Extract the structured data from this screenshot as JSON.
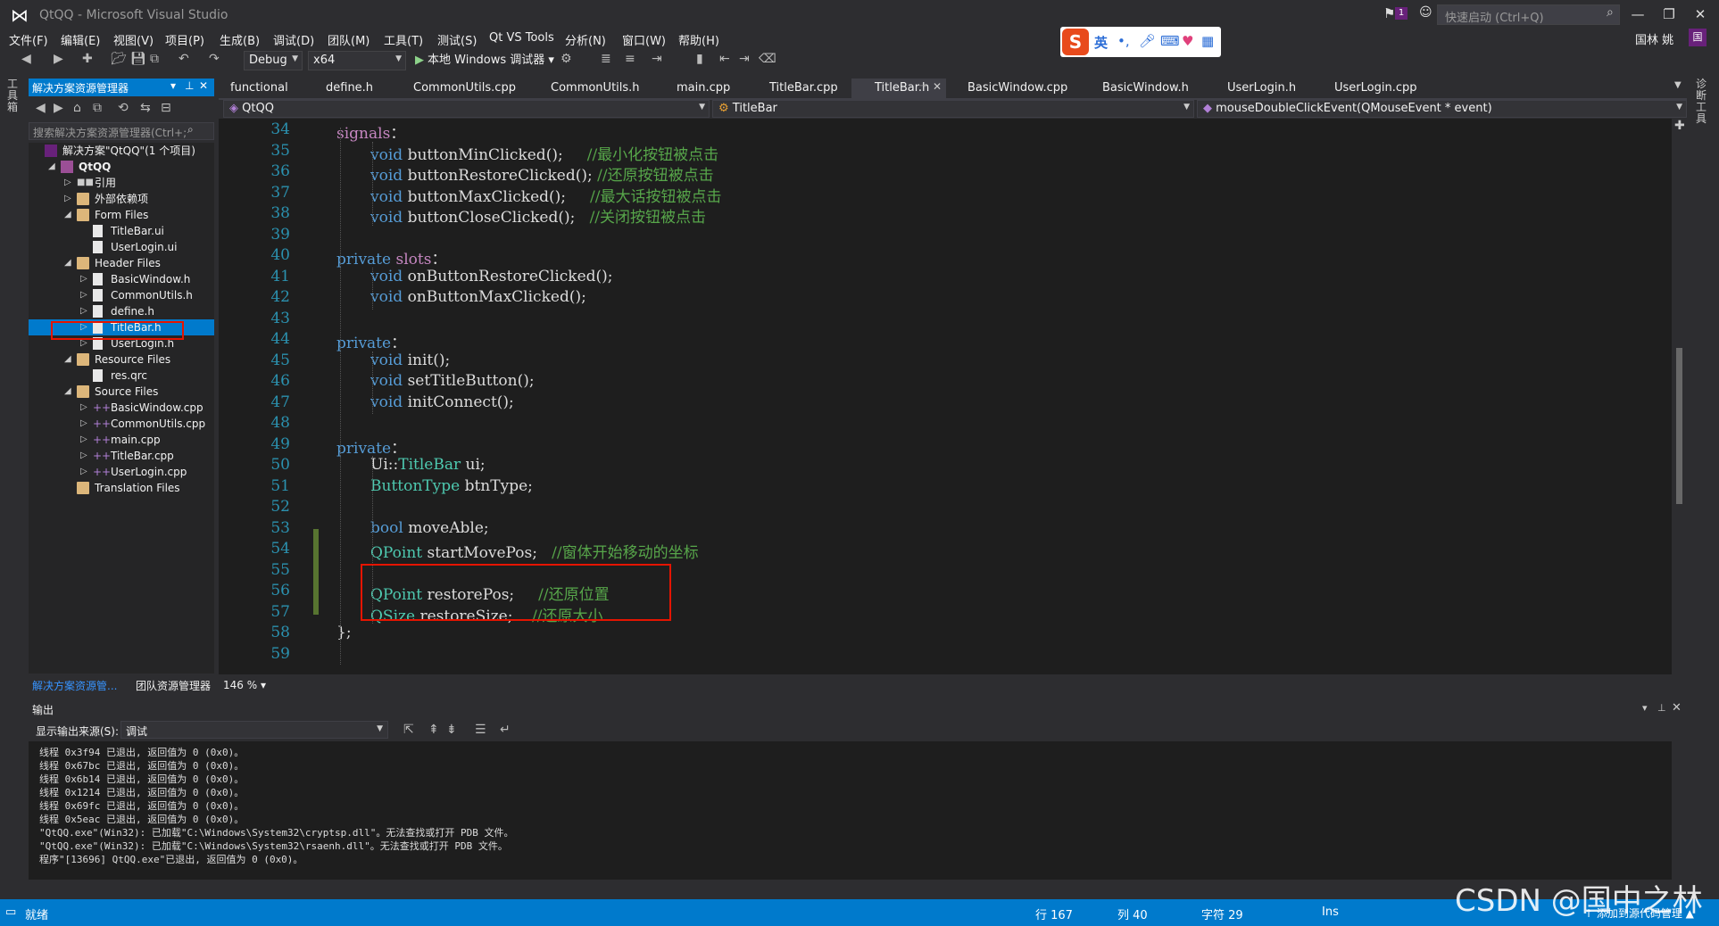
{
  "window": {
    "title": "QtQQ - Microsoft Visual Studio",
    "quick_launch_placeholder": "快速启动 (Ctrl+Q)",
    "notification_count": "1",
    "user_name": "国林 姚",
    "user_initial": "国"
  },
  "menu": [
    "文件(F)",
    "编辑(E)",
    "视图(V)",
    "项目(P)",
    "生成(B)",
    "调试(D)",
    "团队(M)",
    "工具(T)",
    "测试(S)",
    "Qt VS Tools",
    "分析(N)",
    "窗口(W)",
    "帮助(H)"
  ],
  "ime": {
    "lang": "英"
  },
  "toolbar": {
    "config": "Debug",
    "platform": "x64",
    "run_label": "本地 Windows 调试器"
  },
  "left_strip": "工具箱",
  "right_strip": "诊断工具",
  "solution_explorer": {
    "title": "解决方案资源管理器",
    "search_placeholder": "搜索解决方案资源管理器(Ctrl+;",
    "items": [
      {
        "label": "解决方案\"QtQQ\"(1 个项目)",
        "level": 0,
        "icon": "solution-icon",
        "expander": ""
      },
      {
        "label": "QtQQ",
        "level": 1,
        "icon": "project-icon",
        "expander": "◢"
      },
      {
        "label": "引用",
        "level": 2,
        "icon": "references-icon",
        "expander": "▷"
      },
      {
        "label": "外部依赖项",
        "level": 2,
        "icon": "folder-icon",
        "expander": "▷"
      },
      {
        "label": "Form Files",
        "level": 2,
        "icon": "folder-icon",
        "expander": "◢"
      },
      {
        "label": "TitleBar.ui",
        "level": 3,
        "icon": "file-icon",
        "expander": ""
      },
      {
        "label": "UserLogin.ui",
        "level": 3,
        "icon": "file-icon",
        "expander": ""
      },
      {
        "label": "Header Files",
        "level": 2,
        "icon": "folder-icon",
        "expander": "◢"
      },
      {
        "label": "BasicWindow.h",
        "level": 3,
        "icon": "file-icon",
        "expander": "▷"
      },
      {
        "label": "CommonUtils.h",
        "level": 3,
        "icon": "file-icon",
        "expander": "▷"
      },
      {
        "label": "define.h",
        "level": 3,
        "icon": "file-icon",
        "expander": "▷"
      },
      {
        "label": "TitleBar.h",
        "level": 3,
        "icon": "file-icon",
        "expander": "▷",
        "selected": true
      },
      {
        "label": "UserLogin.h",
        "level": 3,
        "icon": "file-icon",
        "expander": "▷"
      },
      {
        "label": "Resource Files",
        "level": 2,
        "icon": "folder-icon",
        "expander": "◢"
      },
      {
        "label": "res.qrc",
        "level": 3,
        "icon": "file-icon",
        "expander": ""
      },
      {
        "label": "Source Files",
        "level": 2,
        "icon": "folder-icon",
        "expander": "◢"
      },
      {
        "label": "BasicWindow.cpp",
        "level": 3,
        "icon": "cpp-file-icon",
        "expander": "▷"
      },
      {
        "label": "CommonUtils.cpp",
        "level": 3,
        "icon": "cpp-file-icon",
        "expander": "▷"
      },
      {
        "label": "main.cpp",
        "level": 3,
        "icon": "cpp-file-icon",
        "expander": "▷"
      },
      {
        "label": "TitleBar.cpp",
        "level": 3,
        "icon": "cpp-file-icon",
        "expander": "▷"
      },
      {
        "label": "UserLogin.cpp",
        "level": 3,
        "icon": "cpp-file-icon",
        "expander": "▷"
      },
      {
        "label": "Translation Files",
        "level": 2,
        "icon": "folder-icon",
        "expander": ""
      }
    ],
    "bottom_tabs": [
      "解决方案资源管...",
      "团队资源管理器"
    ]
  },
  "doc_tabs": [
    "functional",
    "define.h",
    "CommonUtils.cpp",
    "CommonUtils.h",
    "main.cpp",
    "TitleBar.cpp",
    "TitleBar.h",
    "BasicWindow.cpp",
    "BasicWindow.h",
    "UserLogin.h",
    "UserLogin.cpp"
  ],
  "active_tab": "TitleBar.h",
  "nav": {
    "project": "QtQQ",
    "class": "TitleBar",
    "member": "mouseDoubleClickEvent(QMouseEvent * event)"
  },
  "code_lines": [
    {
      "n": "34",
      "indent": 0,
      "tokens": [
        [
          "mc",
          "signals"
        ],
        [
          "",
          "："
        ]
      ]
    },
    {
      "n": "35",
      "indent": 1,
      "tokens": [
        [
          "kw",
          "void"
        ],
        [
          "",
          " buttonMinClicked();     "
        ],
        [
          "cm",
          "//最小化按钮被点击"
        ]
      ]
    },
    {
      "n": "36",
      "indent": 1,
      "tokens": [
        [
          "kw",
          "void"
        ],
        [
          "",
          " buttonRestoreClicked(); "
        ],
        [
          "cm",
          "//还原按钮被点击"
        ]
      ]
    },
    {
      "n": "37",
      "indent": 1,
      "tokens": [
        [
          "kw",
          "void"
        ],
        [
          "",
          " buttonMaxClicked();     "
        ],
        [
          "cm",
          "//最大话按钮被点击"
        ]
      ]
    },
    {
      "n": "38",
      "indent": 1,
      "tokens": [
        [
          "kw",
          "void"
        ],
        [
          "",
          " buttonCloseClicked();   "
        ],
        [
          "cm",
          "//关闭按钮被点击"
        ]
      ]
    },
    {
      "n": "39",
      "indent": 0,
      "tokens": []
    },
    {
      "n": "40",
      "indent": 0,
      "tokens": [
        [
          "kw",
          "private"
        ],
        [
          "",
          " "
        ],
        [
          "mc",
          "slots"
        ],
        [
          "",
          "："
        ]
      ]
    },
    {
      "n": "41",
      "indent": 1,
      "tokens": [
        [
          "kw",
          "void"
        ],
        [
          "",
          " onButtonRestoreClicked();"
        ]
      ]
    },
    {
      "n": "42",
      "indent": 1,
      "tokens": [
        [
          "kw",
          "void"
        ],
        [
          "",
          " onButtonMaxClicked();"
        ]
      ]
    },
    {
      "n": "43",
      "indent": 0,
      "tokens": []
    },
    {
      "n": "44",
      "indent": 0,
      "tokens": [
        [
          "kw",
          "private"
        ],
        [
          "",
          "："
        ]
      ]
    },
    {
      "n": "45",
      "indent": 1,
      "tokens": [
        [
          "kw",
          "void"
        ],
        [
          "",
          " init();"
        ]
      ]
    },
    {
      "n": "46",
      "indent": 1,
      "tokens": [
        [
          "kw",
          "void"
        ],
        [
          "",
          " setTitleButton();"
        ]
      ]
    },
    {
      "n": "47",
      "indent": 1,
      "tokens": [
        [
          "kw",
          "void"
        ],
        [
          "",
          " initConnect();"
        ]
      ]
    },
    {
      "n": "48",
      "indent": 0,
      "tokens": []
    },
    {
      "n": "49",
      "indent": 0,
      "tokens": [
        [
          "kw",
          "private"
        ],
        [
          "",
          "："
        ]
      ]
    },
    {
      "n": "50",
      "indent": 1,
      "tokens": [
        [
          "",
          "Ui::"
        ],
        [
          "ty",
          "TitleBar"
        ],
        [
          "",
          " ui;"
        ]
      ]
    },
    {
      "n": "51",
      "indent": 1,
      "tokens": [
        [
          "ty",
          "ButtonType"
        ],
        [
          "",
          " btnType;"
        ]
      ]
    },
    {
      "n": "52",
      "indent": 0,
      "tokens": []
    },
    {
      "n": "53",
      "indent": 1,
      "tokens": [
        [
          "kw",
          "bool"
        ],
        [
          "",
          " moveAble;"
        ]
      ]
    },
    {
      "n": "54",
      "indent": 1,
      "tokens": [
        [
          "ty",
          "QPoint"
        ],
        [
          "",
          " startMovePos;   "
        ],
        [
          "cm",
          "//窗体开始移动的坐标"
        ]
      ]
    },
    {
      "n": "55",
      "indent": 0,
      "tokens": []
    },
    {
      "n": "56",
      "indent": 1,
      "tokens": [
        [
          "ty",
          "QPoint"
        ],
        [
          "",
          " restorePos;     "
        ],
        [
          "cm",
          "//还原位置"
        ]
      ]
    },
    {
      "n": "57",
      "indent": 1,
      "tokens": [
        [
          "ty",
          "QSize"
        ],
        [
          "",
          " restoreSize;    "
        ],
        [
          "cm",
          "//还原大小"
        ]
      ]
    },
    {
      "n": "58",
      "indent": 0,
      "tokens": [
        [
          "",
          "};"
        ]
      ]
    },
    {
      "n": "59",
      "indent": 0,
      "tokens": []
    }
  ],
  "zoom": "146 %",
  "output": {
    "title": "输出",
    "source_label": "显示输出来源(S):",
    "source_value": "调试",
    "lines": [
      "线程 0x3f94 已退出, 返回值为 0 (0x0)。",
      "线程 0x67bc 已退出, 返回值为 0 (0x0)。",
      "线程 0x6b14 已退出, 返回值为 0 (0x0)。",
      "线程 0x1214 已退出, 返回值为 0 (0x0)。",
      "线程 0x69fc 已退出, 返回值为 0 (0x0)。",
      "线程 0x5eac 已退出, 返回值为 0 (0x0)。",
      "\"QtQQ.exe\"(Win32): 已加载\"C:\\Windows\\System32\\cryptsp.dll\"。无法查找或打开 PDB 文件。",
      "\"QtQQ.exe\"(Win32): 已加载\"C:\\Windows\\System32\\rsaenh.dll\"。无法查找或打开 PDB 文件。",
      "程序\"[13696] QtQQ.exe\"已退出, 返回值为 0 (0x0)。"
    ]
  },
  "status": {
    "ready": "就绪",
    "line": "行 167",
    "col": "列 40",
    "char": "字符 29",
    "mode": "Ins",
    "source_control": "↑ 添加到源代码管理 ▲"
  },
  "watermark": "CSDN @国中之林"
}
